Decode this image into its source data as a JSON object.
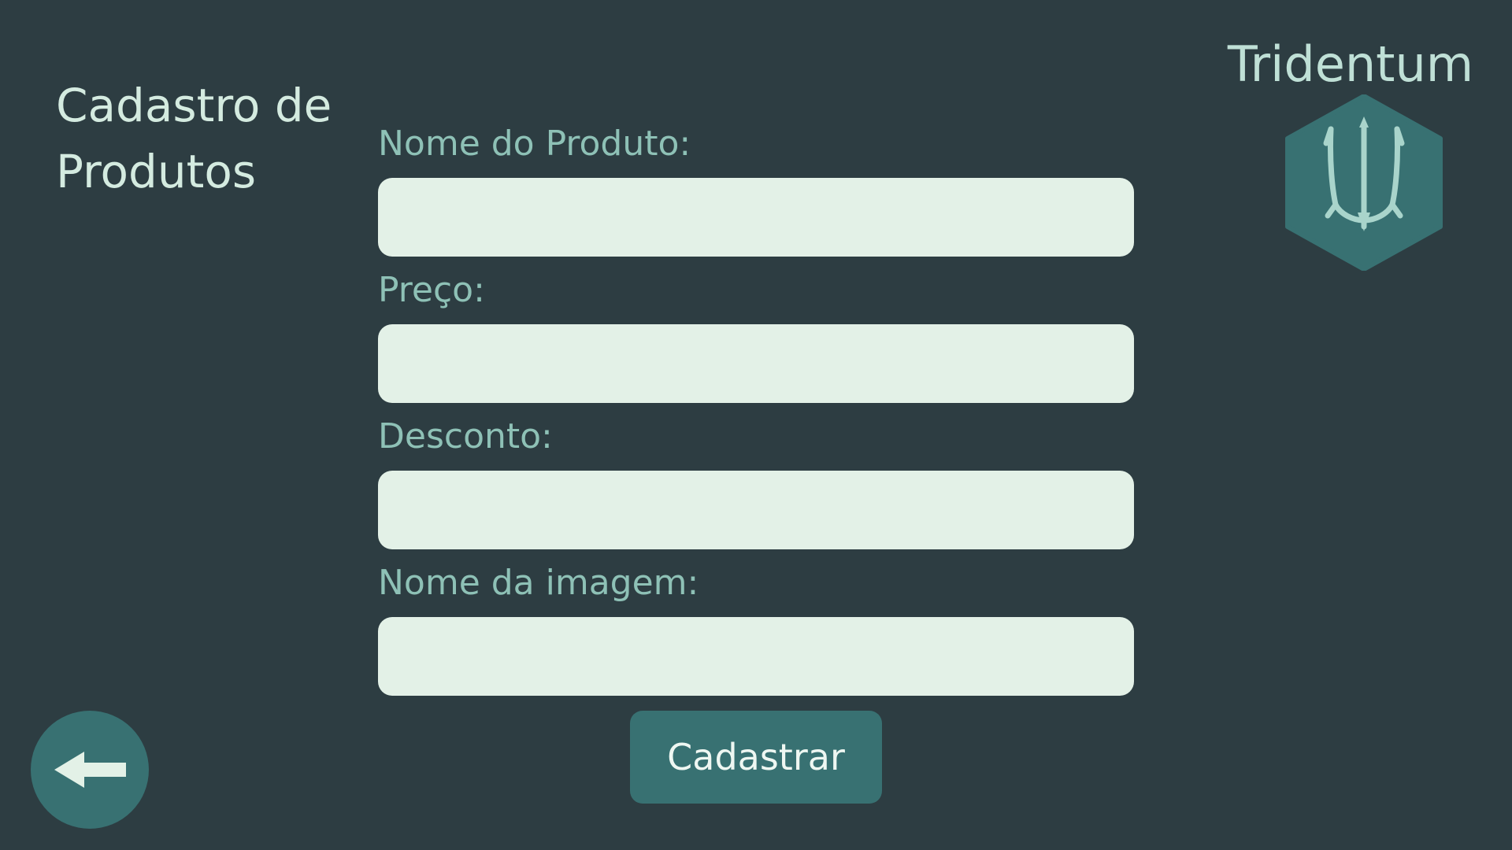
{
  "header": {
    "title_line1": "Cadastro de",
    "title_line2": "Produtos"
  },
  "brand": {
    "name": "Tridentum",
    "logo_icon": "trident-icon"
  },
  "form": {
    "fields": [
      {
        "label": "Nome do Produto:",
        "value": "",
        "placeholder": ""
      },
      {
        "label": "Preço:",
        "value": "",
        "placeholder": ""
      },
      {
        "label": "Desconto:",
        "value": "",
        "placeholder": ""
      },
      {
        "label": "Nome da imagem:",
        "value": "",
        "placeholder": ""
      }
    ],
    "submit_label": "Cadastrar"
  },
  "navigation": {
    "back_icon": "arrow-left-icon"
  },
  "colors": {
    "background": "#2d3d42",
    "accent": "#387172",
    "input_background": "#e3f1e7",
    "label_text": "#8ec1b6",
    "title_text": "#d4ebe0"
  }
}
